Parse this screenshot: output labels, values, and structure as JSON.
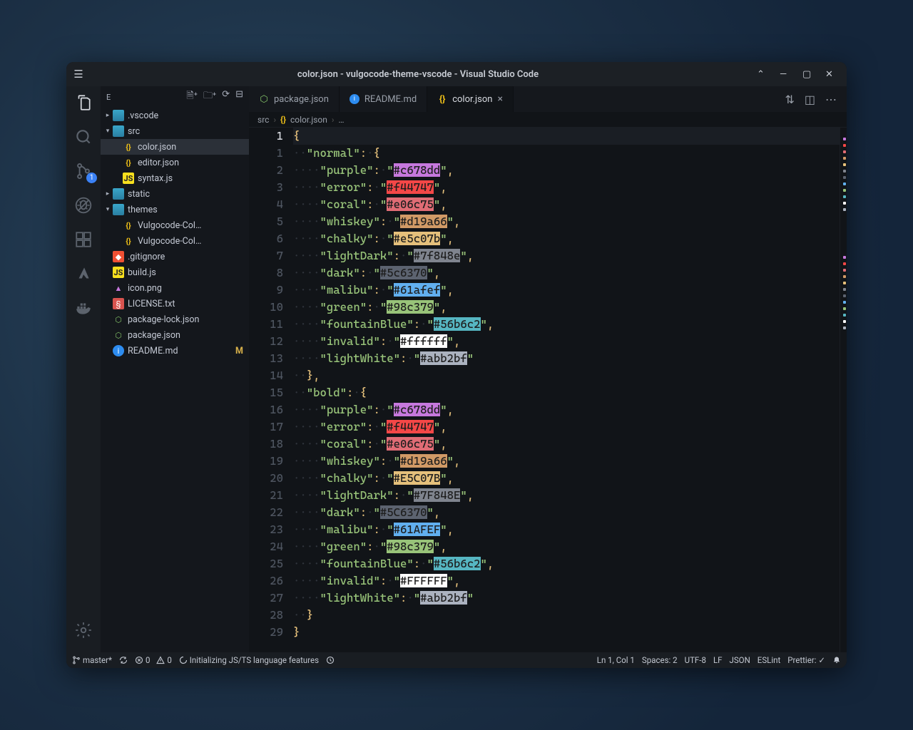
{
  "titlebar": {
    "title": "color.json - vulgocode-theme-vscode - Visual Studio Code"
  },
  "activitybar": {
    "badge": "1"
  },
  "sidebar": {
    "panelLetter": "E",
    "tree": [
      {
        "type": "folder",
        "label": ".vscode",
        "depth": 0,
        "expanded": false,
        "sel": false
      },
      {
        "type": "folder",
        "label": "src",
        "depth": 0,
        "expanded": true,
        "sel": false,
        "green": true
      },
      {
        "type": "file",
        "label": "color.json",
        "depth": 1,
        "icon": "json",
        "sel": true
      },
      {
        "type": "file",
        "label": "editor.json",
        "depth": 1,
        "icon": "json"
      },
      {
        "type": "file",
        "label": "syntax.js",
        "depth": 1,
        "icon": "js"
      },
      {
        "type": "folder",
        "label": "static",
        "depth": 0,
        "expanded": false
      },
      {
        "type": "folder",
        "label": "themes",
        "depth": 0,
        "expanded": true
      },
      {
        "type": "file",
        "label": "Vulgocode-Col…",
        "depth": 1,
        "icon": "json"
      },
      {
        "type": "file",
        "label": "Vulgocode-Col…",
        "depth": 1,
        "icon": "json"
      },
      {
        "type": "file",
        "label": ".gitignore",
        "depth": 0,
        "icon": "git"
      },
      {
        "type": "file",
        "label": "build.js",
        "depth": 0,
        "icon": "js"
      },
      {
        "type": "file",
        "label": "icon.png",
        "depth": 0,
        "icon": "img"
      },
      {
        "type": "file",
        "label": "LICENSE.txt",
        "depth": 0,
        "icon": "lic"
      },
      {
        "type": "file",
        "label": "package-lock.json",
        "depth": 0,
        "icon": "pkg"
      },
      {
        "type": "file",
        "label": "package.json",
        "depth": 0,
        "icon": "pkg"
      },
      {
        "type": "file",
        "label": "README.md",
        "depth": 0,
        "icon": "readme",
        "mod": "M"
      }
    ]
  },
  "tabs": [
    {
      "label": "package.json",
      "icon": "pkg",
      "active": false
    },
    {
      "label": "README.md",
      "icon": "readme",
      "active": false
    },
    {
      "label": "color.json",
      "icon": "json",
      "active": true,
      "dirty": true
    }
  ],
  "breadcrumbs": [
    "src",
    "color.json",
    "…"
  ],
  "code": {
    "line0": {
      "num": "1",
      "content": [
        {
          "t": "{",
          "c": "brace"
        }
      ],
      "indent": 0,
      "cur": true
    },
    "groups": [
      {
        "name": "normal",
        "entries": [
          {
            "key": "purple",
            "hex": "#c678dd"
          },
          {
            "key": "error",
            "hex": "#f44747"
          },
          {
            "key": "coral",
            "hex": "#e06c75"
          },
          {
            "key": "whiskey",
            "hex": "#d19a66"
          },
          {
            "key": "chalky",
            "hex": "#e5c07b"
          },
          {
            "key": "lightDark",
            "hex": "#7f848e"
          },
          {
            "key": "dark",
            "hex": "#5c6370"
          },
          {
            "key": "malibu",
            "hex": "#61afef"
          },
          {
            "key": "green",
            "hex": "#98c379"
          },
          {
            "key": "fountainBlue",
            "hex": "#56b6c2"
          },
          {
            "key": "invalid",
            "hex": "#ffffff"
          },
          {
            "key": "lightWhite",
            "hex": "#abb2bf"
          }
        ]
      },
      {
        "name": "bold",
        "entries": [
          {
            "key": "purple",
            "hex": "#c678dd"
          },
          {
            "key": "error",
            "hex": "#f44747"
          },
          {
            "key": "coral",
            "hex": "#e06c75"
          },
          {
            "key": "whiskey",
            "hex": "#d19a66"
          },
          {
            "key": "chalky",
            "hex": "#E5C07B"
          },
          {
            "key": "lightDark",
            "hex": "#7F848E"
          },
          {
            "key": "dark",
            "hex": "#5C6370"
          },
          {
            "key": "malibu",
            "hex": "#61AFEF"
          },
          {
            "key": "green",
            "hex": "#98c379"
          },
          {
            "key": "fountainBlue",
            "hex": "#56b6c2"
          },
          {
            "key": "invalid",
            "hex": "#FFFFFF"
          },
          {
            "key": "lightWhite",
            "hex": "#abb2bf"
          }
        ]
      }
    ],
    "closingBrace": "}"
  },
  "status": {
    "branch": "master*",
    "errors": "0",
    "warnings": "0",
    "task": "Initializing JS/TS language features",
    "position": "Ln 1, Col 1",
    "indent": "Spaces: 2",
    "encoding": "UTF-8",
    "eol": "LF",
    "lang": "JSON",
    "linter": "ESLint",
    "formatter": "Prettier: ✓"
  }
}
